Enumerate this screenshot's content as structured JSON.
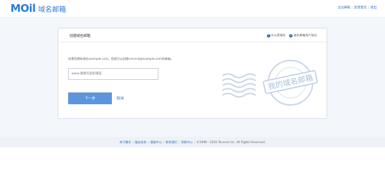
{
  "header": {
    "logo_mail": "MOil",
    "logo_subtitle": "域名邮箱",
    "links": [
      {
        "label": "企业邮箱"
      },
      {
        "label": "反馈意见"
      },
      {
        "label": "退出"
      }
    ]
  },
  "card": {
    "title": "创建域名邮箱",
    "help": [
      {
        "label": "什么是域名"
      },
      {
        "label": "域名邮箱用户协议"
      }
    ],
    "description": "如果您拥有域名example.com，您就可以创建vincent@example.com的邮箱。",
    "input": {
      "value": "",
      "placeholder": "www.请填写您的域名"
    },
    "next_label": "下一步",
    "cancel_label": "取消"
  },
  "stamp": {
    "text": "我的域名邮箱"
  },
  "footer": {
    "links": [
      {
        "label": "关于腾讯"
      },
      {
        "label": "服务条款"
      },
      {
        "label": "客服中心"
      },
      {
        "label": "联系我们"
      },
      {
        "label": "帮助中心"
      }
    ],
    "copyright": "©1998 - 2016 Tencent Inc. All Rights Reserved."
  },
  "colors": {
    "brand": "#2b7cd3",
    "button": "#5b95dc",
    "link": "#2b6cb7",
    "band": "#f3f6fa"
  }
}
